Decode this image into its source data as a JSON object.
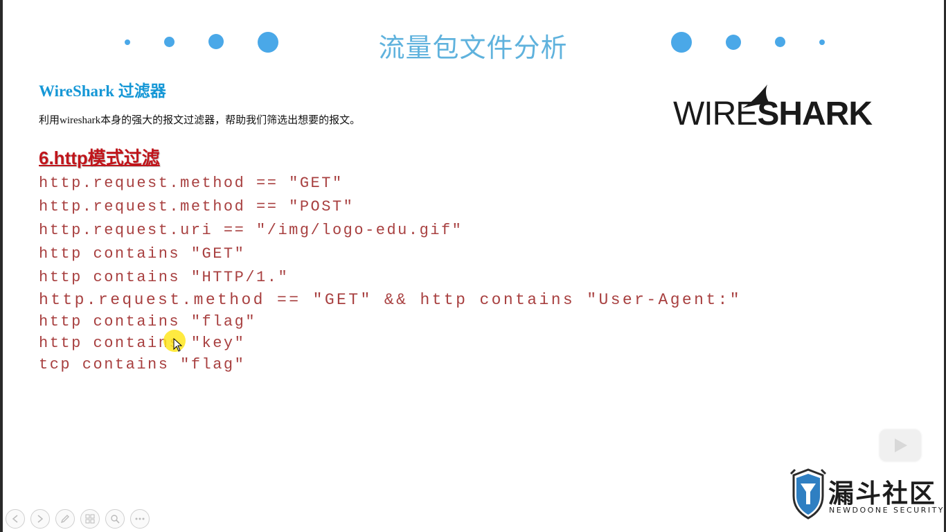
{
  "slide": {
    "title": "流量包文件分析",
    "section_title": "WireShark 过滤器",
    "description": "利用wireshark本身的强大的报文过滤器，帮助我们筛选出想要的报文。",
    "subheading": "6.http模式过滤",
    "filters": [
      "http.request.method == \"GET\"",
      "http.request.method == \"POST\"",
      "http.request.uri == \"/img/logo-edu.gif\"",
      "http contains \"GET\"",
      "http contains \"HTTP/1.\"",
      "http.request.method == \"GET\" && http contains \"User-Agent:\"",
      "http contains \"flag\"",
      "http contains \"key\"",
      "tcp contains \"flag\""
    ]
  },
  "logo": {
    "part1": "WIRE",
    "part2": "SHARK"
  },
  "brand": {
    "name": "漏斗社区",
    "subtitle": "NEWDOONE SECURITY"
  },
  "colors": {
    "title": "#5fb2dd",
    "accent_dots": "#4aa8e8",
    "section_title": "#1597d6",
    "subheading": "#c0151b",
    "code": "#a84040"
  },
  "icons": {
    "play": "play-icon",
    "nav": [
      "prev-icon",
      "next-icon",
      "pen-icon",
      "slides-icon",
      "zoom-icon",
      "more-icon"
    ]
  }
}
